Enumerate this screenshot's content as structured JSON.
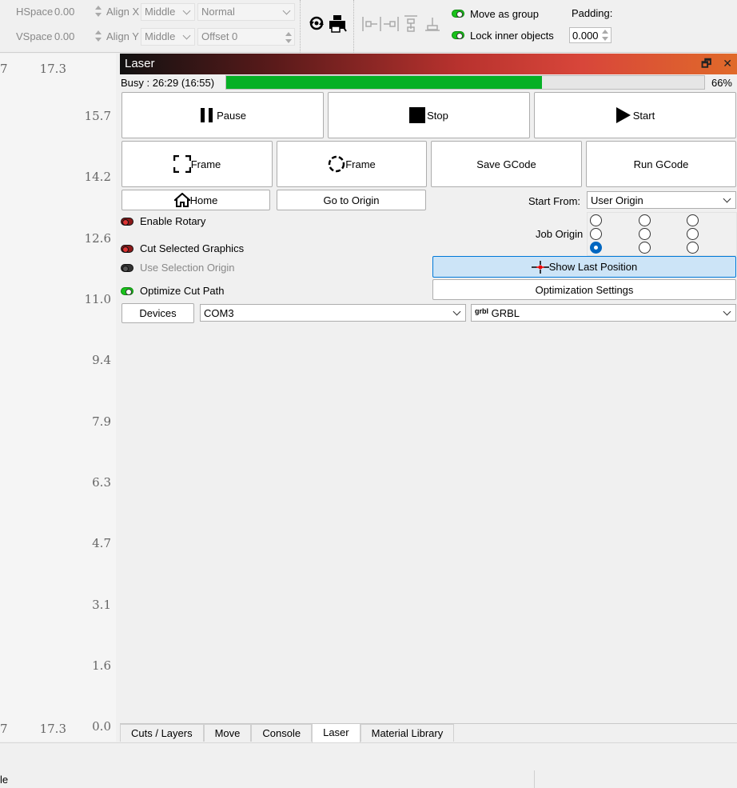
{
  "toolbar": {
    "hspace_label": "HSpace",
    "hspace_value": "0.00",
    "vspace_label": "VSpace",
    "vspace_value": "0.00",
    "alignx_label": "Align X",
    "alignx_value": "Middle",
    "aligny_label": "Align Y",
    "aligny_value": "Middle",
    "mode_value": "Normal",
    "offset_value": "Offset 0",
    "move_as_group": "Move as group",
    "lock_inner": "Lock inner objects",
    "padding_label": "Padding:",
    "padding_value": "0.000"
  },
  "ruler": {
    "top_left": "7",
    "top_right": "17.3",
    "bottom_left": "7",
    "bottom_right": "17.3",
    "ticks": [
      "15.7",
      "14.2",
      "12.6",
      "11.0",
      "9.4",
      "7.9",
      "6.3",
      "4.7",
      "3.1",
      "1.6",
      "0.0"
    ]
  },
  "laser": {
    "title": "Laser",
    "status": "Busy : 26:29 (16:55)",
    "progress": 0.66,
    "progress_text": "66%",
    "pause": "Pause",
    "stop": "Stop",
    "start": "Start",
    "frame1": "Frame",
    "frame2": "Frame",
    "save_gcode": "Save GCode",
    "run_gcode": "Run GCode",
    "home": "Home",
    "go_to_origin": "Go to Origin",
    "start_from_label": "Start From:",
    "start_from_value": "User Origin",
    "enable_rotary": "Enable Rotary",
    "job_origin_label": "Job Origin",
    "cut_selected": "Cut Selected Graphics",
    "use_selection_origin": "Use Selection Origin",
    "show_last_position": "Show Last Position",
    "optimize_cut_path": "Optimize Cut Path",
    "optimization_settings": "Optimization Settings",
    "devices": "Devices",
    "port": "COM3",
    "device_prefix": "grbl",
    "device_value": "GRBL"
  },
  "tabs": [
    "Cuts / Layers",
    "Move",
    "Console",
    "Laser",
    "Material Library"
  ],
  "active_tab": "Laser",
  "status": {
    "left_text": "le"
  }
}
